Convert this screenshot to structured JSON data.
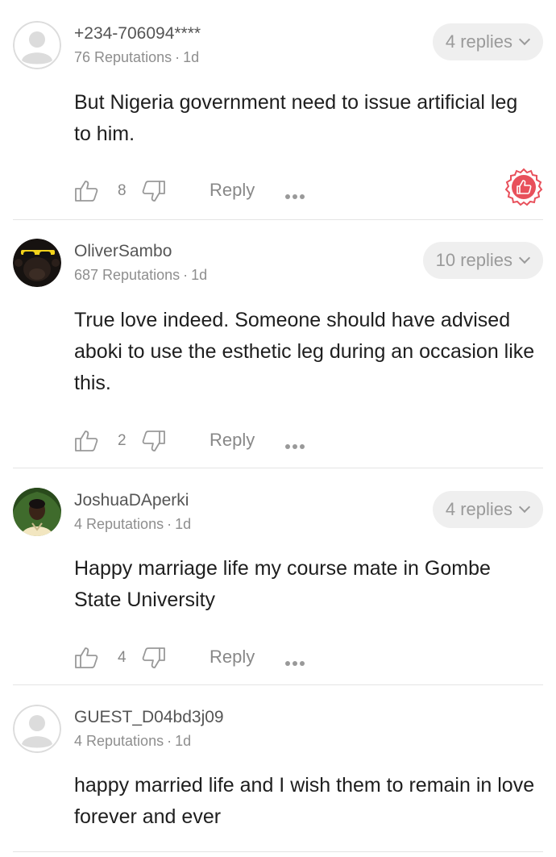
{
  "comments": [
    {
      "name": "+234-706094****",
      "reputation": "76 Reputations",
      "time": "1d",
      "replies": "4 replies",
      "text": "But Nigeria government need to issue artificial leg to him.",
      "likes": "8",
      "reply_label": "Reply",
      "avatar": "default-avatar"
    },
    {
      "name": "OliverSambo",
      "reputation": "687 Reputations",
      "time": "1d",
      "replies": "10 replies",
      "text": "True love indeed. Someone should have advised aboki to use the esthetic leg during an occasion like this.",
      "likes": "2",
      "reply_label": "Reply",
      "avatar": "monkey-sunglasses-avatar"
    },
    {
      "name": "JoshuaDAperki",
      "reputation": "4 Reputations",
      "time": "1d",
      "replies": "4 replies",
      "text": "Happy marriage life my course mate in Gombe State University",
      "likes": "4",
      "reply_label": "Reply",
      "avatar": "photo-avatar"
    },
    {
      "name": "GUEST_D04bd3j09",
      "reputation": "4 Reputations",
      "time": "1d",
      "text": "happy married life and I wish them to remain in love forever and ever",
      "avatar": "default-avatar"
    }
  ],
  "separator": "·",
  "colors": {
    "badge_red": "#e8505b",
    "replies_bg": "#efefef",
    "meta_gray": "#8e8e8e"
  }
}
